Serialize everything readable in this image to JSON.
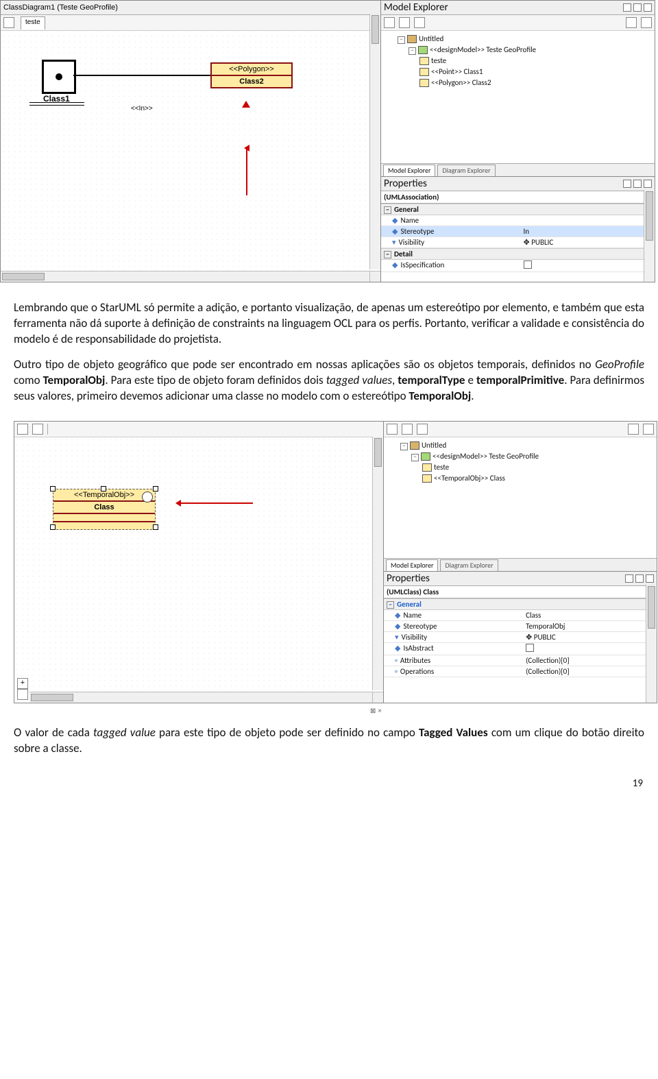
{
  "shot1": {
    "diagram_tab": "ClassDiagram1 (Teste GeoProfile)",
    "teste_tab": "teste",
    "class1": "Class1",
    "class2_stereo": "<<Polygon>>",
    "class2": "Class2",
    "assoc_label": "<<In>>",
    "explorer_title": "Model Explorer",
    "tree": {
      "root": "Untitled",
      "design": "<<designModel>> Teste GeoProfile",
      "teste": "teste",
      "c1": "<<Point>> Class1",
      "c2": "<<Polygon>> Class2"
    },
    "explorer_tab1": "Model Explorer",
    "explorer_tab2": "Diagram Explorer",
    "props_title": "Properties",
    "props_header": "(UMLAssociation)",
    "sect_general": "General",
    "sect_detail": "Detail",
    "rows": {
      "name_k": "Name",
      "name_v": "",
      "stereo_k": "Stereotype",
      "stereo_v": "In",
      "vis_k": "Visibility",
      "vis_v": "PUBLIC",
      "isspec_k": "IsSpecification"
    }
  },
  "para1": "Lembrando que o StarUML só permite a adição, e portanto visualização, de apenas um estereótipo por elemento, e também que esta ferramenta não dá suporte à definição de constraints na linguagem OCL para os perfis. Portanto, verificar a validade e consistência do modelo é de responsabilidade do projetista.",
  "para2_a": "Outro tipo de objeto geográfico que pode ser encontrado em nossas aplicações são os objetos temporais, definidos no ",
  "para2_i1": "GeoProfile",
  "para2_b": " como ",
  "para2_b1": "TemporalObj",
  "para2_c": ". Para este tipo de objeto foram definidos dois ",
  "para2_i2": "tagged values",
  "para2_d": ", ",
  "para2_b2": "temporalType",
  "para2_e": " e ",
  "para2_b3": "temporalPrimitive",
  "para2_f": ". Para definirmos seus valores, primeiro devemos adicionar uma classe no modelo com o estereótipo ",
  "para2_b4": "TemporalObj",
  "para2_g": ".",
  "shot2": {
    "class_stereo": "<<TemporalObj>>",
    "class_name": "Class",
    "tree": {
      "root": "Untitled",
      "design": "<<designModel>> Teste GeoProfile",
      "teste": "teste",
      "c": "<<TemporalObj>> Class"
    },
    "explorer_tab1": "Model Explorer",
    "explorer_tab2": "Diagram Explorer",
    "props_title": "Properties",
    "props_header": "(UMLClass) Class",
    "sect_general": "General",
    "rows": {
      "name_k": "Name",
      "name_v": "Class",
      "stereo_k": "Stereotype",
      "stereo_v": "TemporalObj",
      "vis_k": "Visibility",
      "vis_v": "PUBLIC",
      "isabs_k": "IsAbstract",
      "attr_k": "Attributes",
      "attr_v": "(Collection)[0]",
      "ops_k": "Operations",
      "ops_v": "(Collection)[0]"
    }
  },
  "para3_a": "O valor de cada ",
  "para3_i1": "tagged value",
  "para3_b": " para este tipo de objeto pode ser definido no campo ",
  "para3_b1": "Tagged Values",
  "para3_c": " com um clique do botão direito sobre a classe.",
  "page_number": "19"
}
